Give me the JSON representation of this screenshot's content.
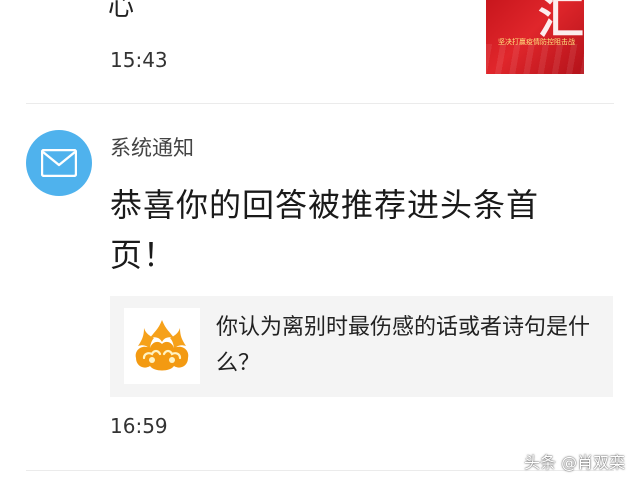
{
  "previous_notification": {
    "text_fragment": "心",
    "time": "15:43",
    "thumbnail_caption": "坚决打赢疫情防控阻击战",
    "thumbnail_glyph": "汇"
  },
  "notification": {
    "sender": "系统通知",
    "message": "恭喜你的回答被推荐进头条首页！",
    "question_card": {
      "title": "你认为离别时最伤感的话或者诗句是什么？",
      "thumbnail_icon": "toutiao-wukong-flame-icon"
    },
    "time": "16:59",
    "avatar_icon": "mail-envelope-icon"
  },
  "watermark": "头条 @肖双栾",
  "colors": {
    "avatar_bg": "#4fb2ed",
    "card_bg": "#f4f4f4",
    "thumb_red": "#c8161d",
    "flame_orange": "#f6a11a"
  }
}
